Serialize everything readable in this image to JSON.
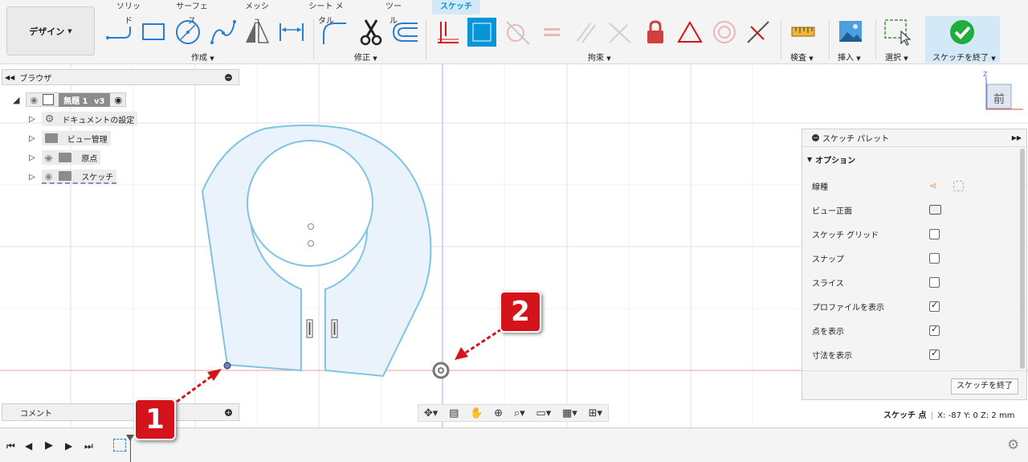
{
  "toolbar": {
    "workspace": "デザイン",
    "tabs": [
      {
        "label": "ソリッド",
        "active": false
      },
      {
        "label": "サーフェス",
        "active": false
      },
      {
        "label": "メッシュ",
        "active": false
      },
      {
        "label": "シート メタル",
        "active": false
      },
      {
        "label": "ツール",
        "active": false
      },
      {
        "label": "スケッチ",
        "active": true
      }
    ],
    "groups": {
      "create": "作成",
      "modify": "修正",
      "constraints": "拘束",
      "inspect": "検査",
      "insert": "挿入",
      "select": "選択",
      "finish": "スケッチを終了"
    }
  },
  "browser": {
    "title": "ブラウザ",
    "root": {
      "name": "無題 1",
      "version": "v3"
    },
    "items": [
      {
        "label": "ドキュメントの設定",
        "icon": "gear-icon"
      },
      {
        "label": "ビュー管理",
        "icon": "folder-icon"
      },
      {
        "label": "原点",
        "icon": "folder-icon"
      },
      {
        "label": "スケッチ",
        "icon": "folder-icon"
      }
    ]
  },
  "comment": {
    "label": "コメント"
  },
  "viewcube": {
    "face": "前",
    "axis": "Z"
  },
  "palette": {
    "title": "スケッチ パレット",
    "section": "オプション",
    "rows": [
      {
        "label": "線種",
        "type": "icon",
        "icon": "linetype-icon"
      },
      {
        "label": "ビュー正面",
        "type": "icon",
        "icon": "look-at-icon"
      },
      {
        "label": "スケッチ グリッド",
        "type": "checkbox",
        "checked": false
      },
      {
        "label": "スナップ",
        "type": "checkbox",
        "checked": false
      },
      {
        "label": "スライス",
        "type": "checkbox",
        "checked": false
      },
      {
        "label": "プロファイルを表示",
        "type": "checkbox",
        "checked": true
      },
      {
        "label": "点を表示",
        "type": "checkbox",
        "checked": true
      },
      {
        "label": "寸法を表示",
        "type": "checkbox",
        "checked": true
      }
    ],
    "finish_button": "スケッチを終了"
  },
  "status": {
    "label": "スケッチ 点",
    "coords": "X: -87 Y: 0 Z: 2 mm"
  },
  "callouts": [
    "1",
    "2"
  ],
  "colors": {
    "accent": "#0696d7",
    "sketch_line": "#7fc4e3",
    "profile_fill": "#eaf3fb",
    "origin_axis_red": "#f0a0a0",
    "callout_red": "#d4141a"
  }
}
